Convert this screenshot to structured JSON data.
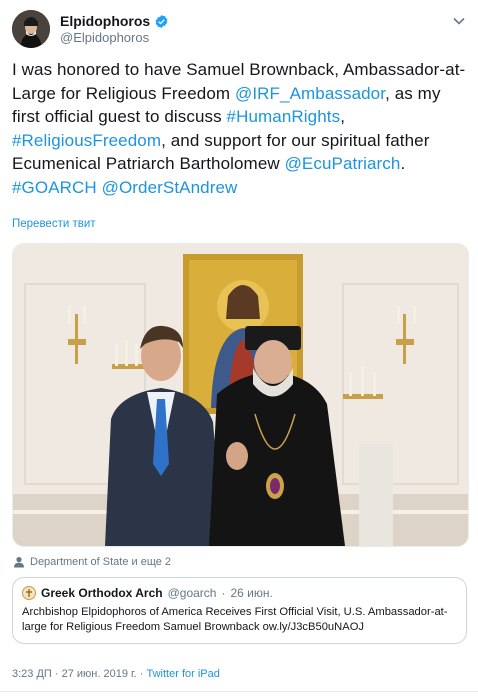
{
  "tweet": {
    "author": {
      "name": "Elpidophoros",
      "handle": "@Elpidophoros",
      "avatar_icon": "person-avatar"
    },
    "text": [
      {
        "t": "I was honored to have Samuel Brownback, Ambassador-at-Large for Religious Freedom "
      },
      {
        "t": "@IRF_Ambassador",
        "link": true
      },
      {
        "t": ", as my first official guest to discuss "
      },
      {
        "t": "#HumanRights",
        "link": true
      },
      {
        "t": ", "
      },
      {
        "t": "#ReligiousFreedom",
        "link": true
      },
      {
        "t": ", and support for our spiritual father Ecumenical Patriarch Bartholomew "
      },
      {
        "t": "@EcuPatriarch",
        "link": true
      },
      {
        "t": ".  "
      },
      {
        "t": "#GOARCH",
        "link": true
      },
      {
        "t": " "
      },
      {
        "t": "@OrderStAndrew",
        "link": true
      }
    ],
    "translate_label": "Перевести твит",
    "tagged_label": "Department of State и еще 2",
    "quote": {
      "name": "Greek Orthodox Arch",
      "handle": "@goarch",
      "separator": "·",
      "date": "26 июн.",
      "text": "Archbishop Elpidophoros of America Receives First Official Visit, U.S. Ambassador-at-large for Religious Freedom Samuel Brownback ow.ly/J3cB50uNAOJ"
    },
    "footer": {
      "time_date": "3:23 ДП · 27 июн. 2019 г. · ",
      "source": "Twitter for iPad"
    }
  },
  "icons": {
    "verified": "verified-badge-icon",
    "caret": "chevron-down-icon",
    "tag": "person-tag-icon"
  },
  "colors": {
    "link": "#1b95e0",
    "secondary": "#657786",
    "text": "#14171a",
    "border": "#ccd6dd"
  }
}
